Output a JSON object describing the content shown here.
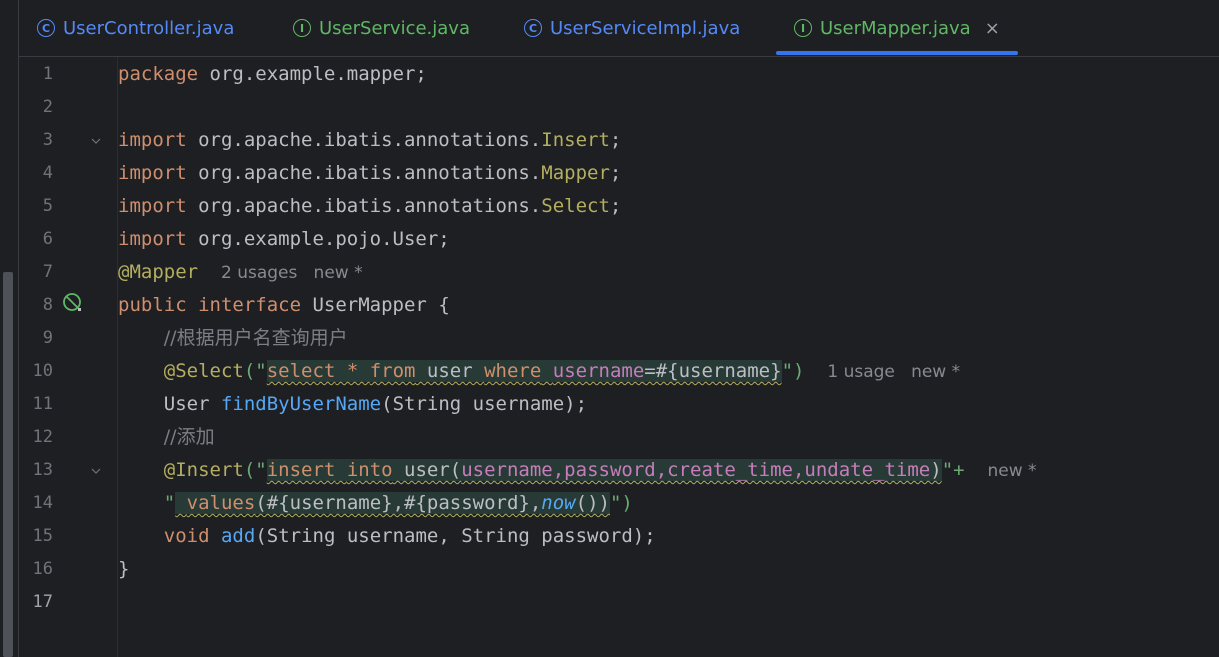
{
  "tabs": [
    {
      "label": "UserController.java",
      "kind": "C",
      "active": false
    },
    {
      "label": "UserService.java",
      "kind": "I",
      "active": false
    },
    {
      "label": "UserServiceImpl.java",
      "kind": "C",
      "active": false
    },
    {
      "label": "UserMapper.java",
      "kind": "I",
      "active": true
    }
  ],
  "close_glyph": "×",
  "line_numbers": [
    "1",
    "2",
    "3",
    "4",
    "5",
    "6",
    "7",
    "8",
    "9",
    "10",
    "11",
    "12",
    "13",
    "14",
    "15",
    "16",
    "17"
  ],
  "code": {
    "l1_kw": "package",
    "l1_rest": " org.example.mapper;",
    "l3_kw": "import",
    "l3_rest": " org.apache.ibatis.annotations.",
    "l3_cls": "Insert",
    "l4_kw": "import",
    "l4_rest": " org.apache.ibatis.annotations.",
    "l4_cls": "Mapper",
    "l5_kw": "import",
    "l5_rest": " org.apache.ibatis.annotations.",
    "l5_cls": "Select",
    "l6_kw": "import",
    "l6_rest": " org.example.pojo.User;",
    "l7_ann": "@Mapper",
    "l7_hint": "2 usages   new *",
    "l8_kw1": "public",
    "l8_kw2": "interface",
    "l8_rest": " UserMapper {",
    "l9_comment": "//根据用户名查询用户",
    "l10_ann": "@Select",
    "l10_open": "(\"",
    "l10_sql_select": "select",
    "l10_sql_star": " * ",
    "l10_sql_from": "from",
    "l10_sql_user": " user ",
    "l10_sql_where": "where",
    "l10_sql_space": " ",
    "l10_sql_col": "username",
    "l10_sql_eq": "=#{username}",
    "l10_close": "\")",
    "l10_hint": "1 usage   new *",
    "l11_type": "User ",
    "l11_fn": "findByUserName",
    "l11_rest": "(String username);",
    "l12_comment": "//添加",
    "l13_ann": "@Insert",
    "l13_open": "(\"",
    "l13_sql_insert": "insert",
    "l13_sql_sp1": " ",
    "l13_sql_into": "into",
    "l13_sql_user": " user(",
    "l13_sql_cols": "username,password,create_time,undate_time",
    "l13_sql_paren": ")",
    "l13_close": "\"+",
    "l13_hint": "new *",
    "l14_open": "\"",
    "l14_sql_sp": " ",
    "l14_sql_values": "values",
    "l14_sql_params": "(#{username},#{password},",
    "l14_sql_now": "now",
    "l14_sql_end": "())",
    "l14_close": "\")",
    "l15_kw": "void",
    "l15_fn": "add",
    "l15_rest": "(String username, String password);",
    "l16": "}"
  },
  "colors": {
    "keyword": "#cf8e6d",
    "annotation": "#b3ae60",
    "function": "#56a8f5",
    "string": "#6aab73",
    "comment": "#7a7e85",
    "sql_column": "#c77dbb",
    "active_tab_underline": "#3574f0"
  },
  "icons": {
    "class_tab": "class-c-icon",
    "interface_tab": "interface-i-icon",
    "bean": "spring-bean-icon",
    "fold": "fold-chevron-icon"
  }
}
